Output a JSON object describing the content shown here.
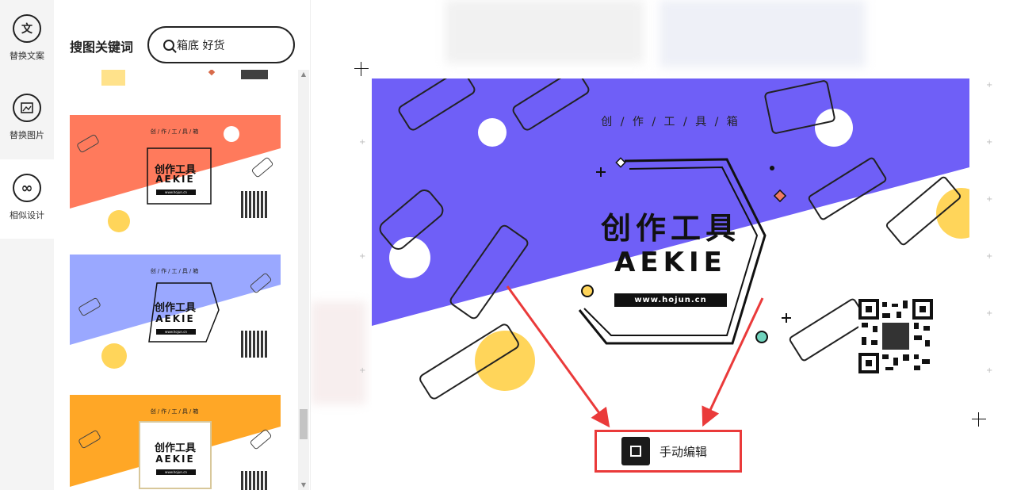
{
  "rail": {
    "items": [
      {
        "icon": "文",
        "label": "替换文案"
      },
      {
        "icon": "▣",
        "label": "替换图片"
      },
      {
        "icon": "∞",
        "label": "相似设计"
      }
    ]
  },
  "panel": {
    "title": "搜图关键词",
    "search_value": "箱底 好货"
  },
  "thumbnails": [
    {
      "subtitle": "创/作/工/具/箱",
      "title": "创作工具",
      "brand": "AEKIE",
      "url": "www.hojun.cn",
      "color": "#ff7a5c"
    },
    {
      "subtitle": "创/作/工/具/箱",
      "title": "创作工具",
      "brand": "AEKIE",
      "url": "www.hojun.cn",
      "color": "#9aa8ff"
    },
    {
      "subtitle": "创/作/工/具/箱",
      "title": "创作工具",
      "brand": "AEKIE",
      "url": "www.hojun.cn",
      "color": "#ffa726"
    }
  ],
  "design": {
    "subtitle": "创 / 作 / 工 / 具 / 箱",
    "title": "创作工具",
    "brand": "AEKIE",
    "url": "www.hojun.cn",
    "primary_color": "#6f5ff7",
    "accent_yellow": "#ffd55a"
  },
  "actions": {
    "manual_edit_label": "手动编辑",
    "highlight_color": "#ea3a3a"
  }
}
